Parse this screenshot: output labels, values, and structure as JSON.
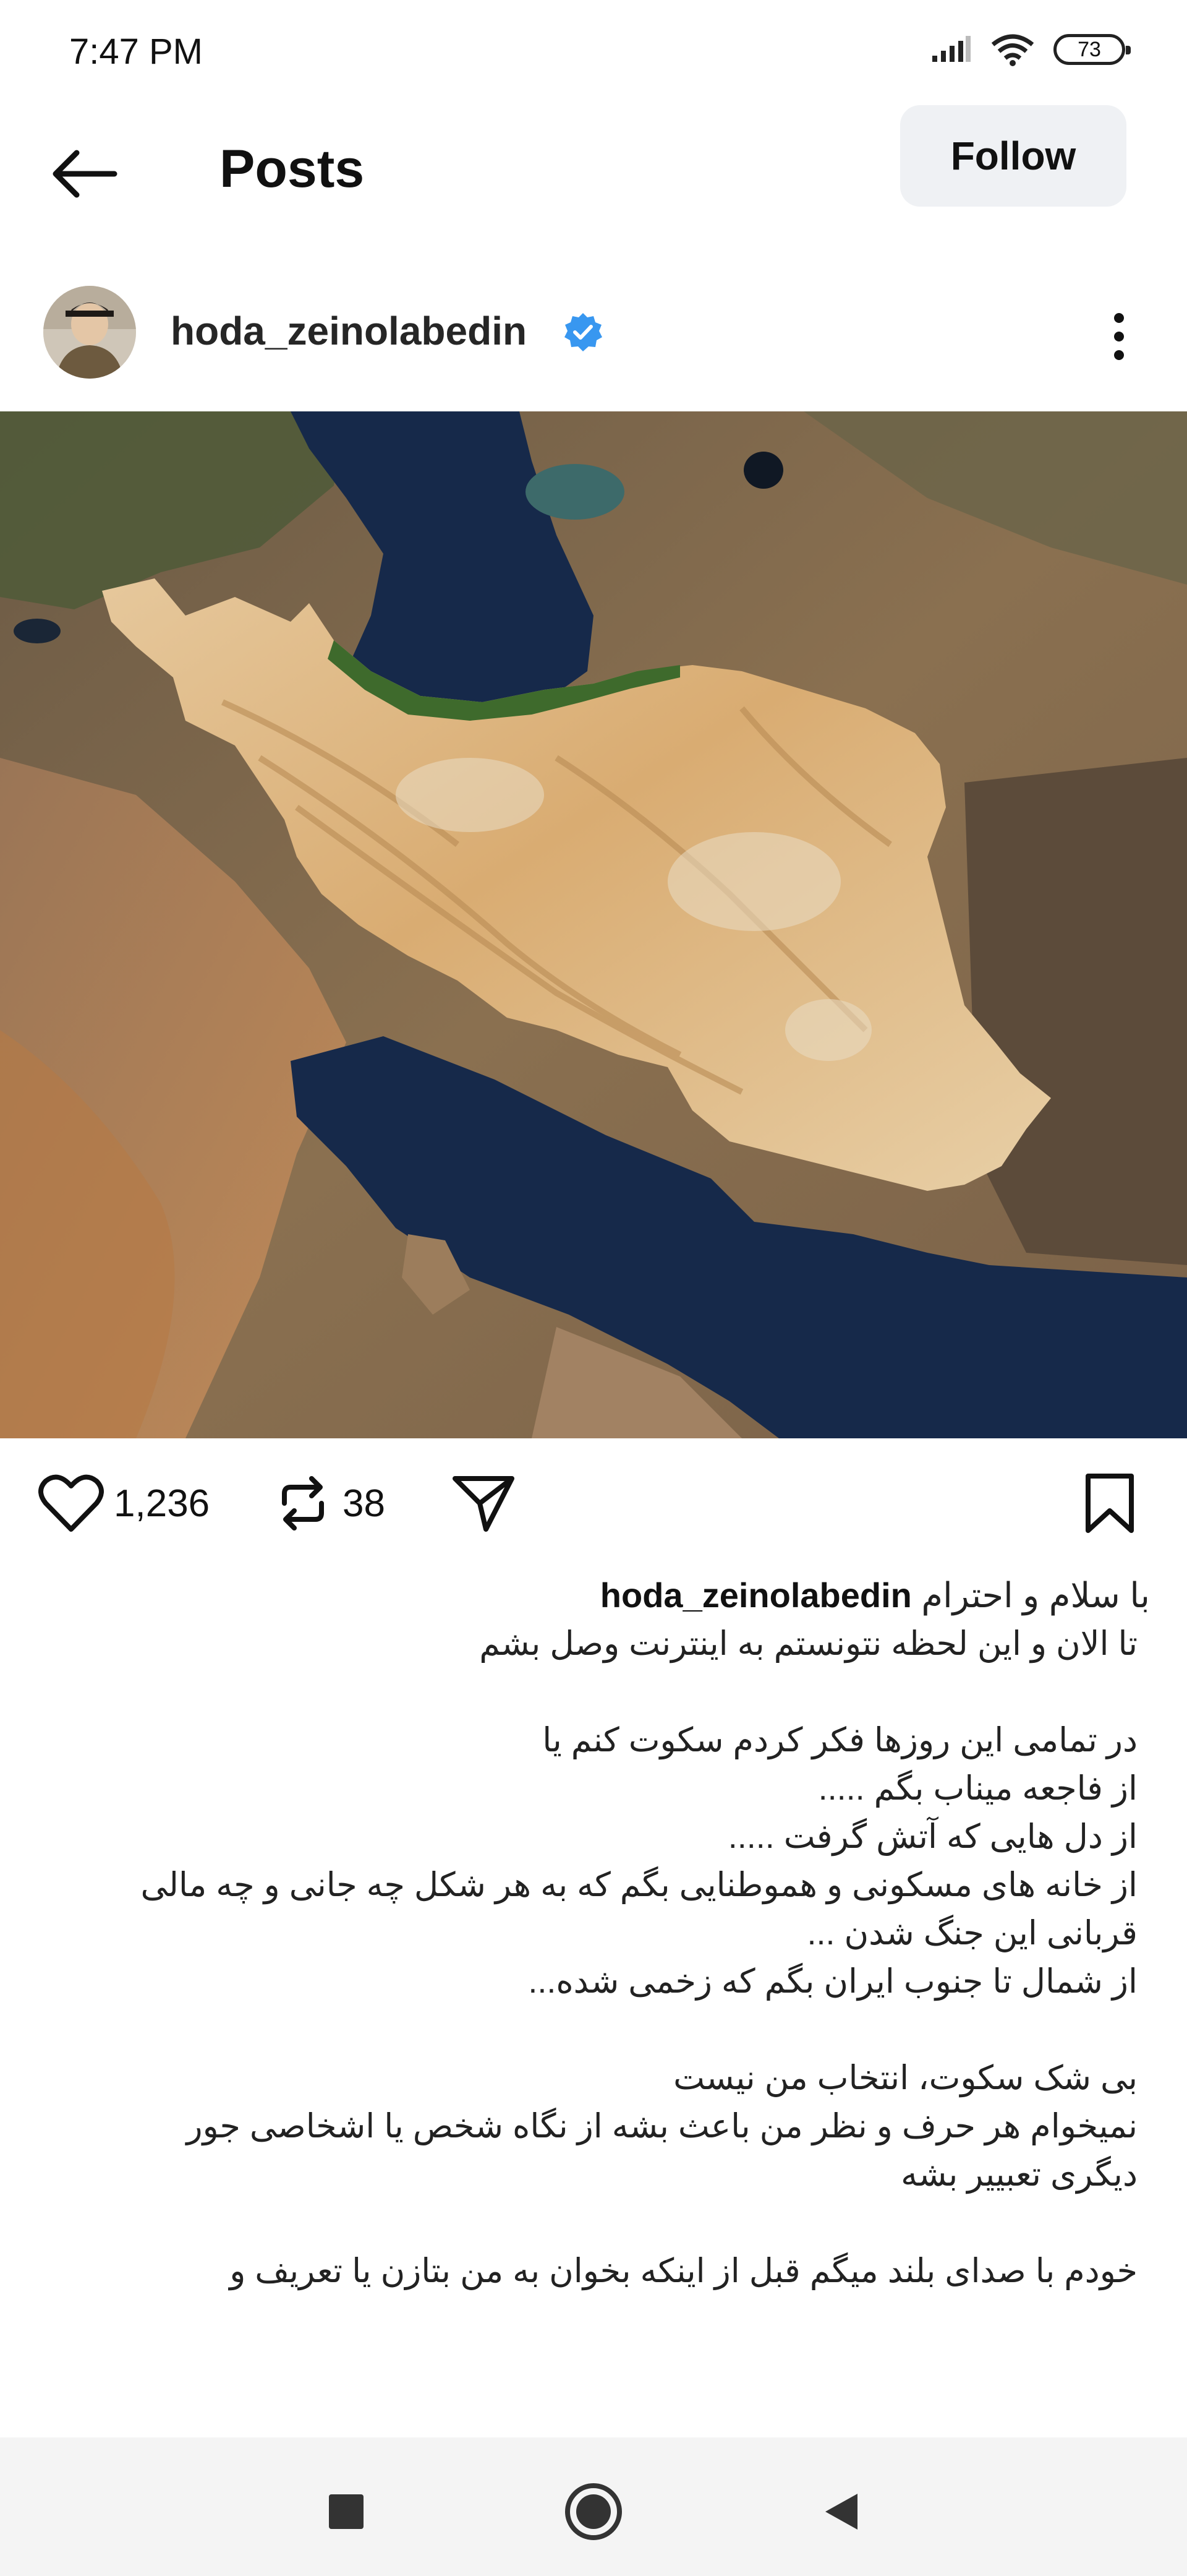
{
  "status_bar": {
    "time": "7:47 PM",
    "battery": "73",
    "icons": [
      "signal-icon",
      "wifi-icon",
      "battery-icon"
    ]
  },
  "header": {
    "title": "Posts",
    "back_icon": "arrow-left-icon",
    "follow_label": "Follow"
  },
  "post": {
    "username": "hoda_zeinolabedin",
    "verified": true,
    "more_icon": "vertical-dots-icon",
    "image_description": "satellite-map-iran",
    "likes": "1,236",
    "reposts": "38",
    "caption_lines": [
      "با سلام و احترام",
      "تا الان و این لحظه نتونستم به اینترنت وصل بشم",
      "",
      "در تمامی این روزها فکر کردم سکوت کنم یا",
      "از فاجعه میناب بگم .....",
      "از دل هایی که آتش گرفت .....",
      "از خانه های مسکونی و هموطنایی بگم که به هر شکل چه جانی و چه مالی",
      "قربانی این جنگ شدن ...",
      "از شمال تا جنوب ایران بگم که زخمی شده...",
      "",
      "بی شک سکوت، انتخاب من نیست",
      "نمیخوام هر حرف و نظر من باعث بشه از نگاه شخص یا اشخاصی جور",
      "دیگری تعبییر بشه",
      "",
      "خودم با صدای بلند میگم قبل از اینکه بخوان به من بتازن یا تعریف و"
    ]
  },
  "colors": {
    "accent_verified": "#3897f0",
    "follow_bg": "#eff1f4",
    "sea": "#16294a"
  },
  "nav": [
    "recents-icon",
    "home-icon",
    "back-triangle-icon"
  ]
}
